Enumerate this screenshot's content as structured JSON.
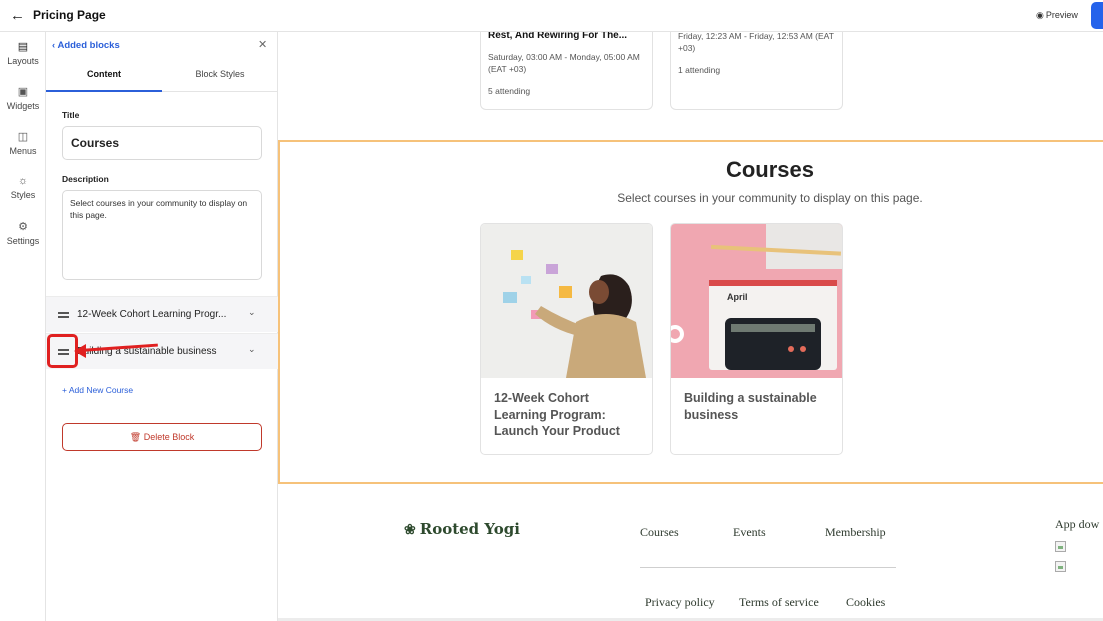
{
  "topbar": {
    "title": "Pricing Page",
    "preview_label": "Preview",
    "primary_color": "#2563eb"
  },
  "rail": {
    "items": [
      {
        "label": "Layouts",
        "icon": "layouts-icon"
      },
      {
        "label": "Widgets",
        "icon": "widgets-icon"
      },
      {
        "label": "Menus",
        "icon": "menus-icon"
      },
      {
        "label": "Styles",
        "icon": "palette-icon"
      },
      {
        "label": "Settings",
        "icon": "gear-icon"
      }
    ]
  },
  "panel": {
    "back_label": "Added blocks",
    "tabs": [
      {
        "label": "Content"
      },
      {
        "label": "Block Styles"
      }
    ],
    "title_label": "Title",
    "title_value": "Courses",
    "description_label": "Description",
    "description_value": "Select courses in your community to display on this page.",
    "courses": [
      {
        "name": "12-Week Cohort Learning Progr..."
      },
      {
        "name": "Building a sustainable business"
      }
    ],
    "add_course_label": "+ Add New Course",
    "delete_label": "Delete Block"
  },
  "main": {
    "events": [
      {
        "title": "Rest, And Rewiring For The...",
        "date": "Saturday, 03:00 AM - Monday, 05:00 AM (EAT +03)",
        "attending": "5 attending"
      },
      {
        "title": "",
        "date": "Friday, 12:23 AM - Friday, 12:53 AM (EAT +03)",
        "attending": "1 attending"
      }
    ],
    "courses_section": {
      "title": "Courses",
      "description": "Select courses in your community to display on this page.",
      "cards": [
        {
          "title": "12-Week Cohort Learning Program: Launch Your Product"
        },
        {
          "title": "Building a sustainable business"
        }
      ]
    },
    "footer": {
      "brand": "Rooted Yogi",
      "links": [
        {
          "label": "Courses"
        },
        {
          "label": "Events"
        },
        {
          "label": "Membership"
        }
      ],
      "legal_links": [
        {
          "label": "Privacy policy"
        },
        {
          "label": "Terms of service"
        },
        {
          "label": "Cookies"
        }
      ],
      "app_download": "App dow"
    }
  },
  "annotation": {
    "color": "#e02020"
  }
}
